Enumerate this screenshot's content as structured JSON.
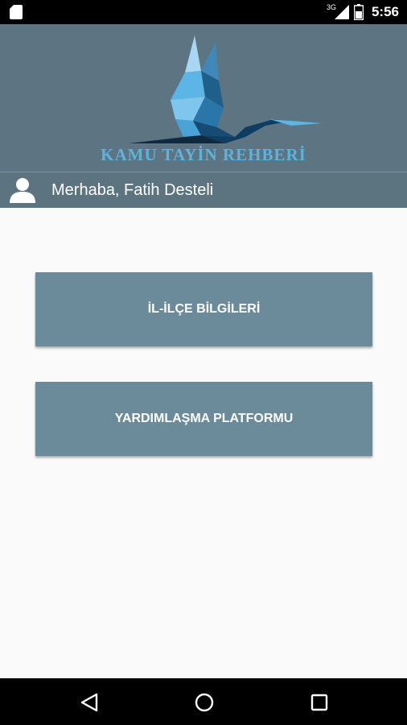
{
  "status_bar": {
    "network": "3G",
    "time": "5:56"
  },
  "header": {
    "logo_text": "KAMU TAYİN REHBERİ",
    "greeting": "Merhaba, Fatih Desteli"
  },
  "menu": [
    {
      "label": "İL-İLÇE BİLGİLERİ"
    },
    {
      "label": "YARDIMLAŞMA PLATFORMU"
    }
  ],
  "icons": {
    "sd_card": "sd-card-icon",
    "signal": "signal-icon",
    "battery": "battery-icon",
    "avatar": "user-icon",
    "back": "back-triangle-icon",
    "home": "home-circle-icon",
    "recent": "recent-square-icon"
  },
  "colors": {
    "header_bg": "#5b7480",
    "button_bg": "#6b8b9a",
    "logo_text": "#5bb3de",
    "page_bg": "#fafafa"
  }
}
